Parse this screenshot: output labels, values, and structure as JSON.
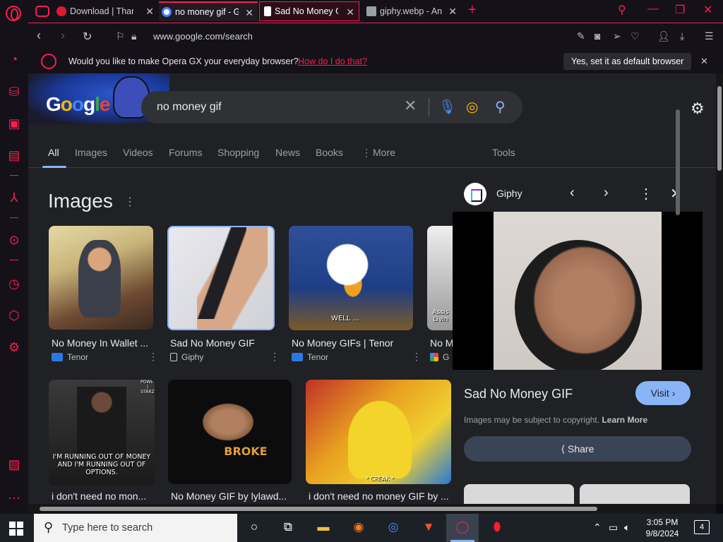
{
  "tabs": [
    {
      "title": "Download | Than",
      "active": false
    },
    {
      "title": "no money gif - G",
      "active": true
    },
    {
      "title": "Sad No Money G",
      "active": false
    },
    {
      "title": "giphy.webp - An",
      "active": false
    }
  ],
  "address": {
    "url": "www.google.com/search"
  },
  "infobar": {
    "message": "Would you like to make Opera GX your everyday browser?",
    "link": "How do I do that?",
    "button": "Yes, set it as default browser"
  },
  "search": {
    "query": "no money gif"
  },
  "google_tabs": [
    "All",
    "Images",
    "Videos",
    "Forums",
    "Shopping",
    "News",
    "Books",
    "More",
    "Tools"
  ],
  "images_heading": "Images",
  "results_row1": [
    {
      "title": "No Money In Wallet ...",
      "source": "Tenor"
    },
    {
      "title": "Sad No Money GIF",
      "source": "Giphy"
    },
    {
      "title": "No Money GIFs | Tenor",
      "source": "Tenor",
      "caption": "WELL ..."
    },
    {
      "title": "No M",
      "source": "G",
      "caption": "Assis\nLivin"
    }
  ],
  "results_row2": [
    {
      "title": "i don't need no mon...",
      "caption": "I'M RUNNING OUT OF MONEY AND I'M RUNNING OUT OF OPTIONS.",
      "corner": "POWER | STARZ"
    },
    {
      "title": "No Money GIF by lylawd...",
      "caption": "BROKE"
    },
    {
      "title": "i don't need no money GIF by ...",
      "caption": "* CREAK *"
    }
  ],
  "panel": {
    "source": "Giphy",
    "title": "Sad No Money GIF",
    "visit": "Visit",
    "copyright": "Images may be subject to copyright.",
    "learn_more": "Learn More",
    "share": "Share"
  },
  "taskbar": {
    "search_placeholder": "Type here to search",
    "time": "3:05 PM",
    "date": "9/8/2024",
    "notifications": "4"
  },
  "colors": {
    "opera_accent": "#fa1e4e",
    "google_bg": "#202124",
    "link_blue": "#8ab4f8"
  }
}
